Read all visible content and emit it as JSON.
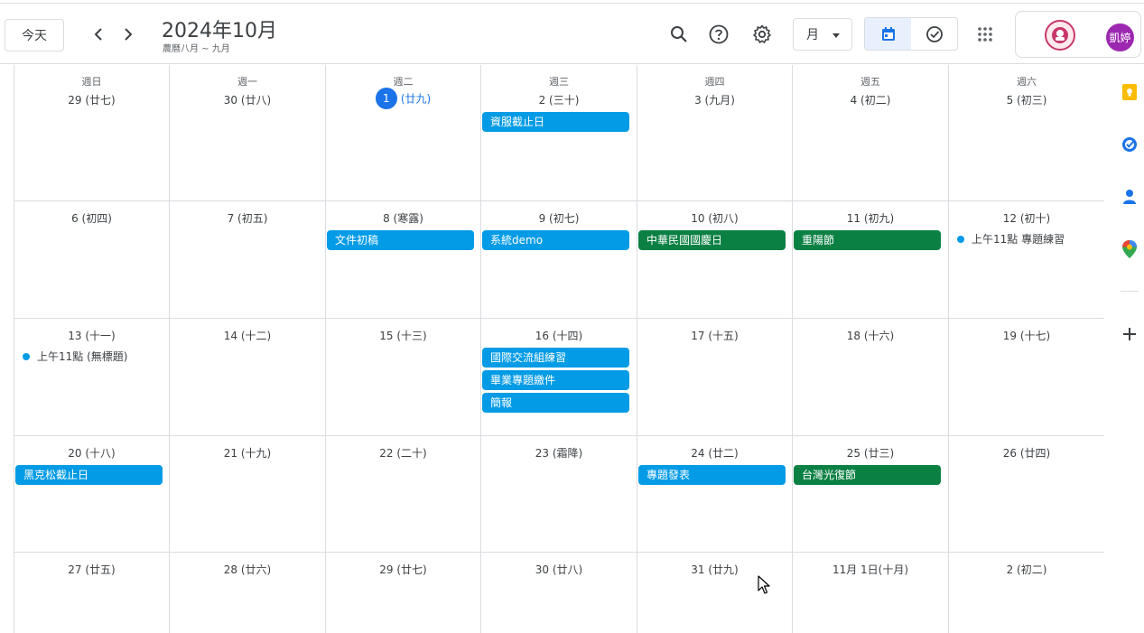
{
  "header": {
    "today_label": "今天",
    "title": "2024年10月",
    "subtitle": "農曆八月 ~ 九月",
    "view_label": "月",
    "avatar_text": "凱婷"
  },
  "icons": {
    "search": "search-icon",
    "help": "help-icon",
    "settings": "gear-icon",
    "calendar_view": "calendar-icon",
    "tasks_view": "check-circle-icon",
    "apps": "apps-grid-icon"
  },
  "colors": {
    "accent": "#1a73e8",
    "event_blue": "#039be5",
    "event_green": "#0b8043",
    "avatar": "#9c27b0"
  },
  "weekdays": [
    "週日",
    "週一",
    "週二",
    "週三",
    "週四",
    "週五",
    "週六"
  ],
  "weeks": [
    {
      "days": [
        {
          "label": "29 (廿七)",
          "events": [],
          "dots": []
        },
        {
          "label": "30 (廿八)",
          "events": [],
          "dots": []
        },
        {
          "label": "(廿九)",
          "today_num": "1",
          "today": true,
          "events": [],
          "dots": []
        },
        {
          "label": "2 (三十)",
          "events": [
            {
              "title": "資服截止日",
              "color": "blue"
            }
          ],
          "dots": []
        },
        {
          "label": "3 (九月)",
          "events": [],
          "dots": []
        },
        {
          "label": "4 (初二)",
          "events": [],
          "dots": []
        },
        {
          "label": "5 (初三)",
          "events": [],
          "dots": []
        }
      ]
    },
    {
      "days": [
        {
          "label": "6 (初四)",
          "events": [],
          "dots": []
        },
        {
          "label": "7 (初五)",
          "events": [],
          "dots": []
        },
        {
          "label": "8 (寒露)",
          "events": [
            {
              "title": "文件初稿",
              "color": "blue"
            }
          ],
          "dots": []
        },
        {
          "label": "9 (初七)",
          "events": [
            {
              "title": "系統demo",
              "color": "blue"
            }
          ],
          "dots": []
        },
        {
          "label": "10 (初八)",
          "events": [
            {
              "title": "中華民國國慶日",
              "color": "green"
            }
          ],
          "dots": []
        },
        {
          "label": "11 (初九)",
          "events": [
            {
              "title": "重陽節",
              "color": "green"
            }
          ],
          "dots": []
        },
        {
          "label": "12 (初十)",
          "events": [],
          "dots": [
            {
              "title": "上午11點 專題練習"
            }
          ]
        }
      ]
    },
    {
      "days": [
        {
          "label": "13 (十一)",
          "events": [],
          "dots": [
            {
              "title": "上午11點 (無標題)"
            }
          ]
        },
        {
          "label": "14 (十二)",
          "events": [],
          "dots": []
        },
        {
          "label": "15 (十三)",
          "events": [],
          "dots": []
        },
        {
          "label": "16 (十四)",
          "events": [
            {
              "title": "國際交流組練習",
              "color": "blue"
            },
            {
              "title": "畢業專題繳件",
              "color": "blue"
            },
            {
              "title": "簡報",
              "color": "blue"
            }
          ],
          "dots": []
        },
        {
          "label": "17 (十五)",
          "events": [],
          "dots": []
        },
        {
          "label": "18 (十六)",
          "events": [],
          "dots": []
        },
        {
          "label": "19 (十七)",
          "events": [],
          "dots": []
        }
      ]
    },
    {
      "days": [
        {
          "label": "20 (十八)",
          "events": [
            {
              "title": "黑克松截止日",
              "color": "blue"
            }
          ],
          "dots": []
        },
        {
          "label": "21 (十九)",
          "events": [],
          "dots": []
        },
        {
          "label": "22 (二十)",
          "events": [],
          "dots": []
        },
        {
          "label": "23 (霜降)",
          "events": [],
          "dots": []
        },
        {
          "label": "24 (廿二)",
          "events": [
            {
              "title": "專題發表",
              "color": "blue"
            }
          ],
          "dots": []
        },
        {
          "label": "25 (廿三)",
          "events": [
            {
              "title": "台灣光復節",
              "color": "green"
            }
          ],
          "dots": []
        },
        {
          "label": "26 (廿四)",
          "events": [],
          "dots": []
        }
      ]
    },
    {
      "days": [
        {
          "label": "27 (廿五)",
          "events": [],
          "dots": []
        },
        {
          "label": "28 (廿六)",
          "events": [],
          "dots": []
        },
        {
          "label": "29 (廿七)",
          "events": [],
          "dots": []
        },
        {
          "label": "30 (廿八)",
          "events": [],
          "dots": []
        },
        {
          "label": "31 (廿九)",
          "events": [],
          "dots": []
        },
        {
          "label": "11月 1日(十月)",
          "events": [],
          "dots": []
        },
        {
          "label": "2 (初二)",
          "events": [],
          "dots": []
        }
      ]
    }
  ],
  "side_panel": [
    "keep-icon",
    "tasks-icon",
    "contacts-icon",
    "maps-icon",
    "add-icon"
  ]
}
